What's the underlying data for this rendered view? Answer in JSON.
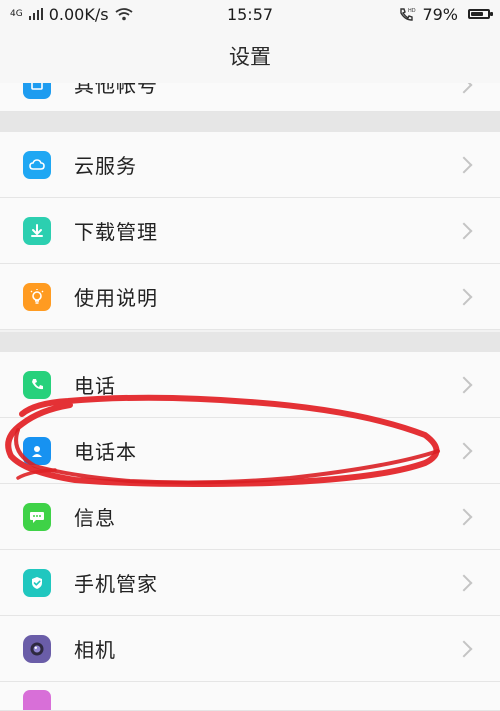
{
  "status_bar": {
    "network_speed": "0.00K/s",
    "time": "15:57",
    "battery": "79%",
    "hd_label": "HD",
    "signal_label": "4G",
    "battery_level": 0.79
  },
  "header": {
    "title": "设置"
  },
  "sections": [
    {
      "items": [
        {
          "label": "其他帐号",
          "icon": "account-icon",
          "color": "#1e9cf0"
        }
      ]
    },
    {
      "items": [
        {
          "label": "云服务",
          "icon": "cloud-icon",
          "color": "#1fa7f3"
        },
        {
          "label": "下载管理",
          "icon": "download-icon",
          "color": "#2ccfb0"
        },
        {
          "label": "使用说明",
          "icon": "light-bulb-icon",
          "color": "#ff9b21"
        }
      ]
    },
    {
      "items": [
        {
          "label": "电话",
          "icon": "phone-icon",
          "color": "#27d17c"
        },
        {
          "label": "电话本",
          "icon": "contacts-icon",
          "color": "#1792f1"
        },
        {
          "label": "信息",
          "icon": "message-icon",
          "color": "#3fd247"
        },
        {
          "label": "手机管家",
          "icon": "shield-icon",
          "color": "#20c7bf"
        },
        {
          "label": "相机",
          "icon": "camera-icon",
          "color": "#6a5da8"
        }
      ]
    }
  ]
}
